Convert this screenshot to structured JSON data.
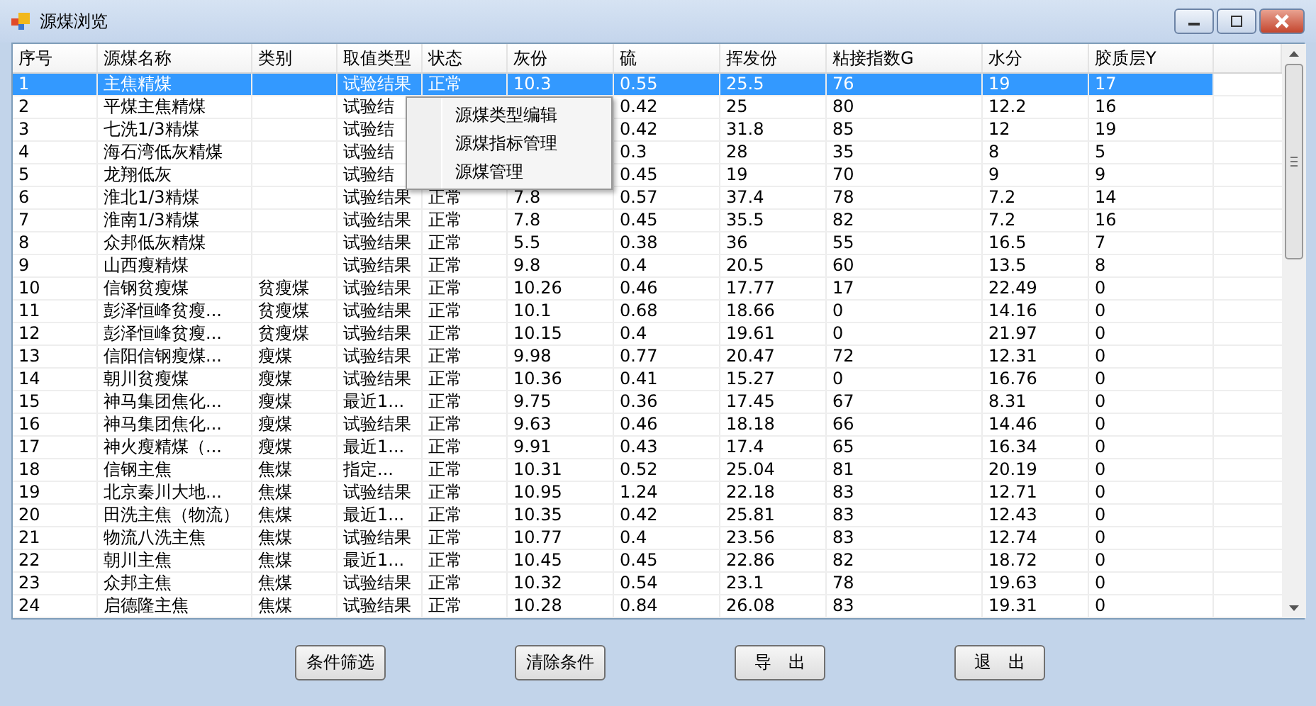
{
  "window": {
    "title": "源煤浏览"
  },
  "table": {
    "columns": [
      "序号",
      "源煤名称",
      "类别",
      "取值类型",
      "状态",
      "灰份",
      "硫",
      "挥发份",
      "粘接指数G",
      "水分",
      "胶质层Y"
    ],
    "rows": [
      {
        "selected": true,
        "no": "1",
        "name": "主焦精煤",
        "value_type": "试验结果",
        "status": "正常",
        "ash": "10.3",
        "sulfur": "0.55",
        "volatile": "25.5",
        "g_index": "76",
        "moisture": "19",
        "y_layer": "17"
      },
      {
        "selected": false,
        "no": "2",
        "name": "平煤主焦精煤",
        "value_type": "试验结",
        "sulfur": "0.42",
        "volatile": "25",
        "g_index": "80",
        "moisture": "12.2",
        "y_layer": "16"
      },
      {
        "selected": false,
        "no": "3",
        "name": "七洗1/3精煤",
        "value_type": "试验结",
        "sulfur": "0.42",
        "volatile": "31.8",
        "g_index": "85",
        "moisture": "12",
        "y_layer": "19"
      },
      {
        "selected": false,
        "no": "4",
        "name": "海石湾低灰精煤",
        "value_type": "试验结",
        "sulfur": "0.3",
        "volatile": "28",
        "g_index": "35",
        "moisture": "8",
        "y_layer": "5"
      },
      {
        "selected": false,
        "no": "5",
        "name": "龙翔低灰",
        "value_type": "试验结",
        "sulfur": "0.45",
        "volatile": "19",
        "g_index": "70",
        "moisture": "9",
        "y_layer": "9"
      },
      {
        "selected": false,
        "no": "6",
        "name": "淮北1/3精煤",
        "value_type": "试验结果",
        "status": "正常",
        "ash": "7.8",
        "sulfur": "0.57",
        "volatile": "37.4",
        "g_index": "78",
        "moisture": "7.2",
        "y_layer": "14"
      },
      {
        "selected": false,
        "no": "7",
        "name": "淮南1/3精煤",
        "value_type": "试验结果",
        "status": "正常",
        "ash": "7.8",
        "sulfur": "0.45",
        "volatile": "35.5",
        "g_index": "82",
        "moisture": "7.2",
        "y_layer": "16"
      },
      {
        "selected": false,
        "no": "8",
        "name": "众邦低灰精煤",
        "value_type": "试验结果",
        "status": "正常",
        "ash": "5.5",
        "sulfur": "0.38",
        "volatile": "36",
        "g_index": "55",
        "moisture": "16.5",
        "y_layer": "7"
      },
      {
        "selected": false,
        "no": "9",
        "name": "山西瘦精煤",
        "value_type": "试验结果",
        "status": "正常",
        "ash": "9.8",
        "sulfur": "0.4",
        "volatile": "20.5",
        "g_index": "60",
        "moisture": "13.5",
        "y_layer": "8"
      },
      {
        "selected": false,
        "no": "10",
        "name": "信钢贫瘦煤",
        "category": "贫瘦煤",
        "value_type": "试验结果",
        "status": "正常",
        "ash": "10.26",
        "sulfur": "0.46",
        "volatile": "17.77",
        "g_index": "17",
        "moisture": "22.49",
        "y_layer": "0"
      },
      {
        "selected": false,
        "no": "11",
        "name": "彭泽恒峰贫瘦...",
        "category": "贫瘦煤",
        "value_type": "试验结果",
        "status": "正常",
        "ash": "10.1",
        "sulfur": "0.68",
        "volatile": "18.66",
        "g_index": "0",
        "moisture": "14.16",
        "y_layer": "0"
      },
      {
        "selected": false,
        "no": "12",
        "name": "彭泽恒峰贫瘦...",
        "category": "贫瘦煤",
        "value_type": "试验结果",
        "status": "正常",
        "ash": "10.15",
        "sulfur": "0.4",
        "volatile": "19.61",
        "g_index": "0",
        "moisture": "21.97",
        "y_layer": "0"
      },
      {
        "selected": false,
        "no": "13",
        "name": "信阳信钢瘦煤...",
        "category": "瘦煤",
        "value_type": "试验结果",
        "status": "正常",
        "ash": "9.98",
        "sulfur": "0.77",
        "volatile": "20.47",
        "g_index": "72",
        "moisture": "12.31",
        "y_layer": "0"
      },
      {
        "selected": false,
        "no": "14",
        "name": "朝川贫瘦煤",
        "category": "瘦煤",
        "value_type": "试验结果",
        "status": "正常",
        "ash": "10.36",
        "sulfur": "0.41",
        "volatile": "15.27",
        "g_index": "0",
        "moisture": "16.76",
        "y_layer": "0"
      },
      {
        "selected": false,
        "no": "15",
        "name": "神马集团焦化...",
        "category": "瘦煤",
        "value_type": "最近1...",
        "status": "正常",
        "ash": "9.75",
        "sulfur": "0.36",
        "volatile": "17.45",
        "g_index": "67",
        "moisture": "8.31",
        "y_layer": "0"
      },
      {
        "selected": false,
        "no": "16",
        "name": "神马集团焦化...",
        "category": "瘦煤",
        "value_type": "试验结果",
        "status": "正常",
        "ash": "9.63",
        "sulfur": "0.46",
        "volatile": "18.18",
        "g_index": "66",
        "moisture": "14.46",
        "y_layer": "0"
      },
      {
        "selected": false,
        "no": "17",
        "name": "神火瘦精煤（...",
        "category": "瘦煤",
        "value_type": "最近1...",
        "status": "正常",
        "ash": "9.91",
        "sulfur": "0.43",
        "volatile": "17.4",
        "g_index": "65",
        "moisture": "16.34",
        "y_layer": "0"
      },
      {
        "selected": false,
        "no": "18",
        "name": "信钢主焦",
        "category": "焦煤",
        "value_type": "指定...",
        "status": "正常",
        "ash": "10.31",
        "sulfur": "0.52",
        "volatile": "25.04",
        "g_index": "81",
        "moisture": "20.19",
        "y_layer": "0"
      },
      {
        "selected": false,
        "no": "19",
        "name": "北京秦川大地...",
        "category": "焦煤",
        "value_type": "试验结果",
        "status": "正常",
        "ash": "10.95",
        "sulfur": "1.24",
        "volatile": "22.18",
        "g_index": "83",
        "moisture": "12.71",
        "y_layer": "0"
      },
      {
        "selected": false,
        "no": "20",
        "name": "田洗主焦（物流）",
        "category": "焦煤",
        "value_type": "最近1...",
        "status": "正常",
        "ash": "10.35",
        "sulfur": "0.42",
        "volatile": "25.81",
        "g_index": "83",
        "moisture": "12.43",
        "y_layer": "0"
      },
      {
        "selected": false,
        "no": "21",
        "name": "物流八洗主焦",
        "category": "焦煤",
        "value_type": "试验结果",
        "status": "正常",
        "ash": "10.77",
        "sulfur": "0.4",
        "volatile": "23.56",
        "g_index": "83",
        "moisture": "12.74",
        "y_layer": "0"
      },
      {
        "selected": false,
        "no": "22",
        "name": "朝川主焦",
        "category": "焦煤",
        "value_type": "最近1...",
        "status": "正常",
        "ash": "10.45",
        "sulfur": "0.45",
        "volatile": "22.86",
        "g_index": "82",
        "moisture": "18.72",
        "y_layer": "0"
      },
      {
        "selected": false,
        "no": "23",
        "name": "众邦主焦",
        "category": "焦煤",
        "value_type": "试验结果",
        "status": "正常",
        "ash": "10.32",
        "sulfur": "0.54",
        "volatile": "23.1",
        "g_index": "78",
        "moisture": "19.63",
        "y_layer": "0"
      },
      {
        "selected": false,
        "no": "24",
        "name": "启德隆主焦",
        "category": "焦煤",
        "value_type": "试验结果",
        "status": "正常",
        "ash": "10.28",
        "sulfur": "0.84",
        "volatile": "26.08",
        "g_index": "83",
        "moisture": "19.31",
        "y_layer": "0"
      }
    ]
  },
  "context_menu": {
    "items": [
      "源煤类型编辑",
      "源煤指标管理",
      "源煤管理"
    ]
  },
  "buttons": [
    "条件筛选",
    "清除条件",
    "导　出",
    "退　出"
  ]
}
